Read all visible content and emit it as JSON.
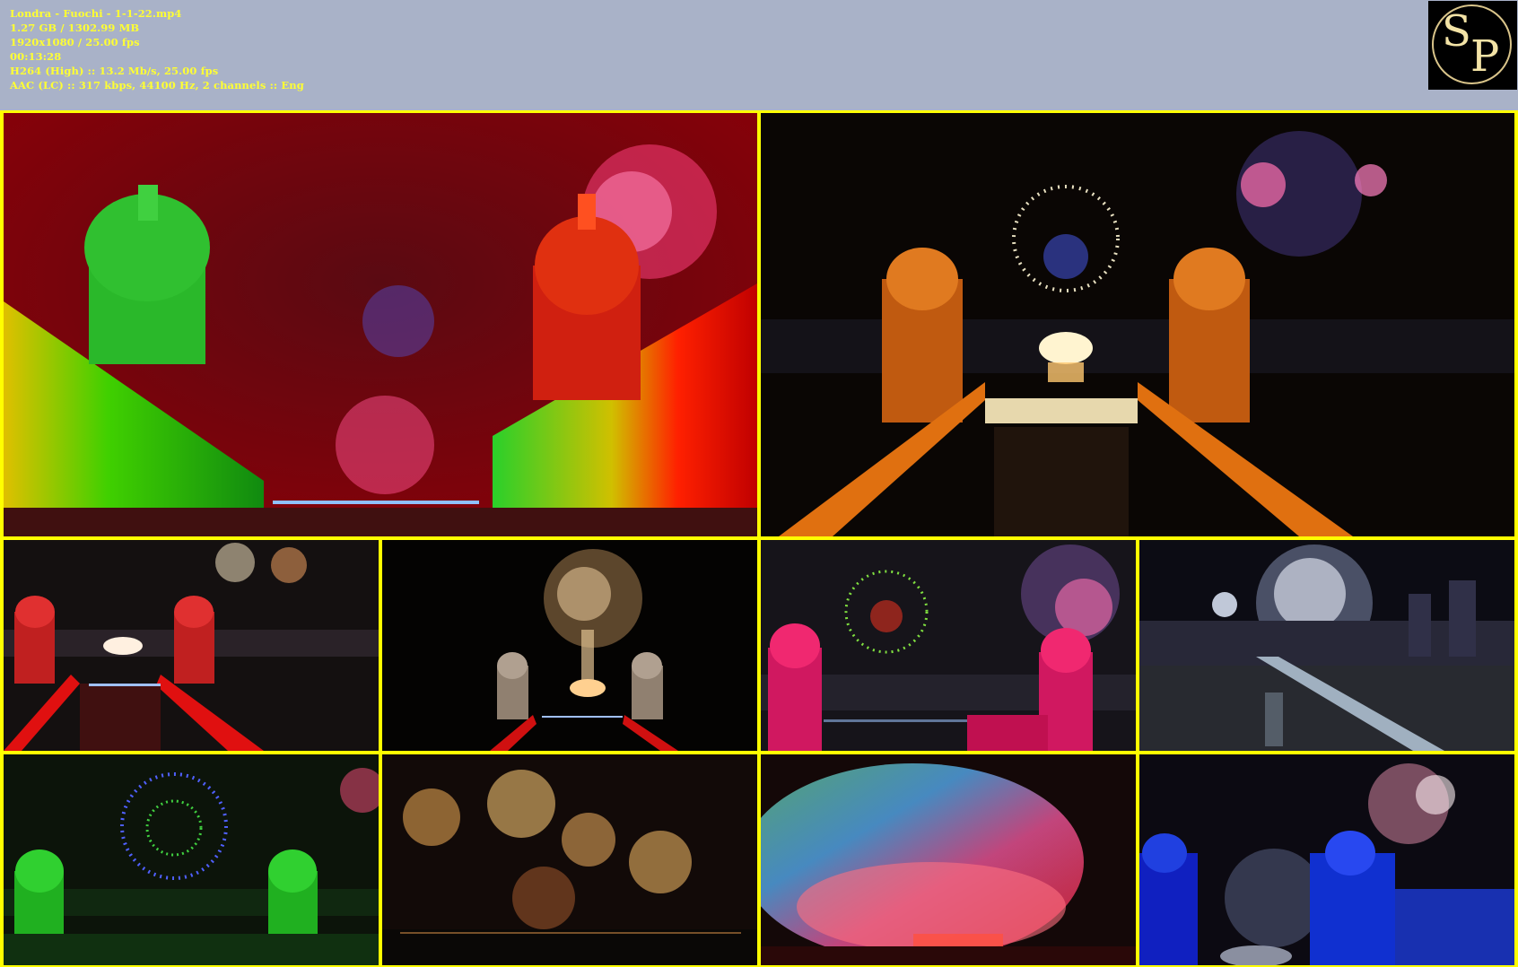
{
  "file_info": {
    "filename": "Londra - Fuochi - 1-1-22.mp4",
    "size": "1.27 GB / 1302.99 MB",
    "resolution": "1920x1080 / 25.00 fps",
    "duration": "00:13:28",
    "video": "H264 (High) :: 13.2 Mb/s, 25.00 fps",
    "audio": "AAC (LC) :: 317 kbps, 44100 Hz, 2 channels :: Eng"
  },
  "logo": {
    "letter_1": "S",
    "letter_2": "P"
  },
  "colors": {
    "header_bg": "#a9b2c8",
    "info_text": "#ffff33",
    "grid_border": "#ffff00"
  },
  "thumbnails": [
    {
      "scene": "red-green-domes-fireworks"
    },
    {
      "scene": "orange-domes-drone-face"
    },
    {
      "scene": "red-domes-river-fireworks"
    },
    {
      "scene": "gold-fireworks-domes"
    },
    {
      "scene": "magenta-domes-drone-lion"
    },
    {
      "scene": "white-fireworks-bridge-city"
    },
    {
      "scene": "green-domes-drone-heart"
    },
    {
      "scene": "gold-fireworks-smoke"
    },
    {
      "scene": "rainbow-smoke-fireworks"
    },
    {
      "scene": "blue-domes-fireworks"
    }
  ]
}
